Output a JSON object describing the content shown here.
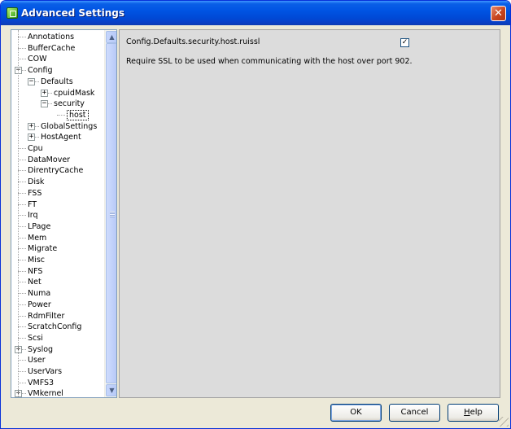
{
  "window": {
    "title": "Advanced Settings",
    "close_symbol": "✕"
  },
  "tree": {
    "items": [
      {
        "label": "Annotations",
        "level": 1,
        "expander": "none"
      },
      {
        "label": "BufferCache",
        "level": 1,
        "expander": "none"
      },
      {
        "label": "COW",
        "level": 1,
        "expander": "none"
      },
      {
        "label": "Config",
        "level": 1,
        "expander": "minus"
      },
      {
        "label": "Defaults",
        "level": 2,
        "expander": "minus"
      },
      {
        "label": "cpuidMask",
        "level": 3,
        "expander": "plus"
      },
      {
        "label": "security",
        "level": 3,
        "expander": "minus"
      },
      {
        "label": "host",
        "level": 4,
        "expander": "none",
        "selected": true
      },
      {
        "label": "GlobalSettings",
        "level": 2,
        "expander": "plus"
      },
      {
        "label": "HostAgent",
        "level": 2,
        "expander": "plus"
      },
      {
        "label": "Cpu",
        "level": 1,
        "expander": "none"
      },
      {
        "label": "DataMover",
        "level": 1,
        "expander": "none"
      },
      {
        "label": "DirentryCache",
        "level": 1,
        "expander": "none"
      },
      {
        "label": "Disk",
        "level": 1,
        "expander": "none"
      },
      {
        "label": "FSS",
        "level": 1,
        "expander": "none"
      },
      {
        "label": "FT",
        "level": 1,
        "expander": "none"
      },
      {
        "label": "Irq",
        "level": 1,
        "expander": "none"
      },
      {
        "label": "LPage",
        "level": 1,
        "expander": "none"
      },
      {
        "label": "Mem",
        "level": 1,
        "expander": "none"
      },
      {
        "label": "Migrate",
        "level": 1,
        "expander": "none"
      },
      {
        "label": "Misc",
        "level": 1,
        "expander": "none"
      },
      {
        "label": "NFS",
        "level": 1,
        "expander": "none"
      },
      {
        "label": "Net",
        "level": 1,
        "expander": "none"
      },
      {
        "label": "Numa",
        "level": 1,
        "expander": "none"
      },
      {
        "label": "Power",
        "level": 1,
        "expander": "none"
      },
      {
        "label": "RdmFilter",
        "level": 1,
        "expander": "none"
      },
      {
        "label": "ScratchConfig",
        "level": 1,
        "expander": "none"
      },
      {
        "label": "Scsi",
        "level": 1,
        "expander": "none"
      },
      {
        "label": "Syslog",
        "level": 1,
        "expander": "plus"
      },
      {
        "label": "User",
        "level": 1,
        "expander": "none"
      },
      {
        "label": "UserVars",
        "level": 1,
        "expander": "none"
      },
      {
        "label": "VMFS3",
        "level": 1,
        "expander": "none"
      },
      {
        "label": "VMkernel",
        "level": 1,
        "expander": "plus"
      }
    ],
    "scroll_up_symbol": "▲",
    "scroll_down_symbol": "▼"
  },
  "detail": {
    "setting_name": "Config.Defaults.security.host.ruissl",
    "checked": true,
    "check_symbol": "✓",
    "description": "Require SSL to be used when communicating with the host over port 902."
  },
  "buttons": {
    "ok": "OK",
    "cancel": "Cancel",
    "help_underlined": "H",
    "help_rest": "elp"
  }
}
